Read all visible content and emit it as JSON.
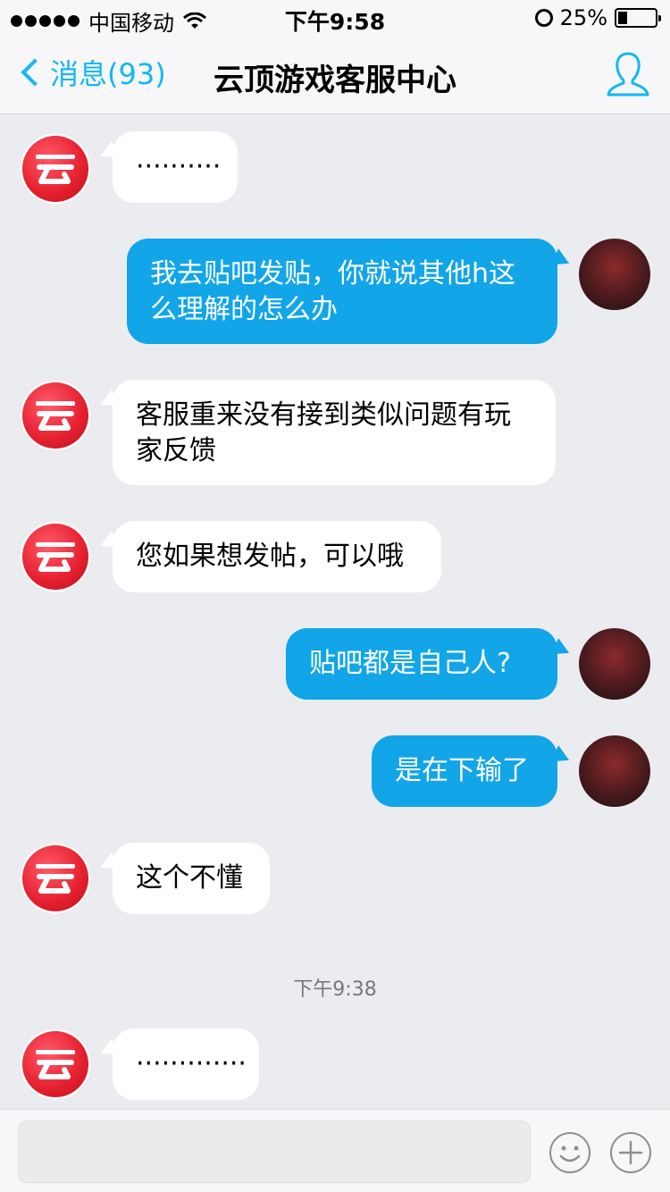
{
  "status_bar": {
    "carrier": "中国移动",
    "time": "下午9:58",
    "battery": "25%",
    "battery_level": 0.25
  },
  "nav": {
    "back_label": "消息(93)",
    "title": "云顶游戏客服中心"
  },
  "messages": [
    {
      "side": "in",
      "text": "··········"
    },
    {
      "side": "out",
      "text": "我去贴吧发贴，你就说其他h这么理解的怎么办"
    },
    {
      "side": "in",
      "text": "客服重来没有接到类似问题有玩家反馈"
    },
    {
      "side": "in",
      "text": "您如果想发帖，可以哦"
    },
    {
      "side": "out",
      "text": "贴吧都是自己人?"
    },
    {
      "side": "out",
      "text": "是在下输了"
    },
    {
      "side": "in",
      "text": "这个不懂"
    },
    {
      "side": "in",
      "text": "·············"
    }
  ],
  "timestamp": "下午9:38",
  "input": {
    "value": "",
    "placeholder": ""
  },
  "colors": {
    "accent": "#12b7f5",
    "outgoing_bubble": "#12a5e8",
    "incoming_bubble": "#ffffff",
    "background": "#ebecf0"
  },
  "icons": {
    "back": "chevron-left-icon",
    "profile": "person-icon",
    "emoji": "smiley-icon",
    "plus": "plus-icon"
  }
}
